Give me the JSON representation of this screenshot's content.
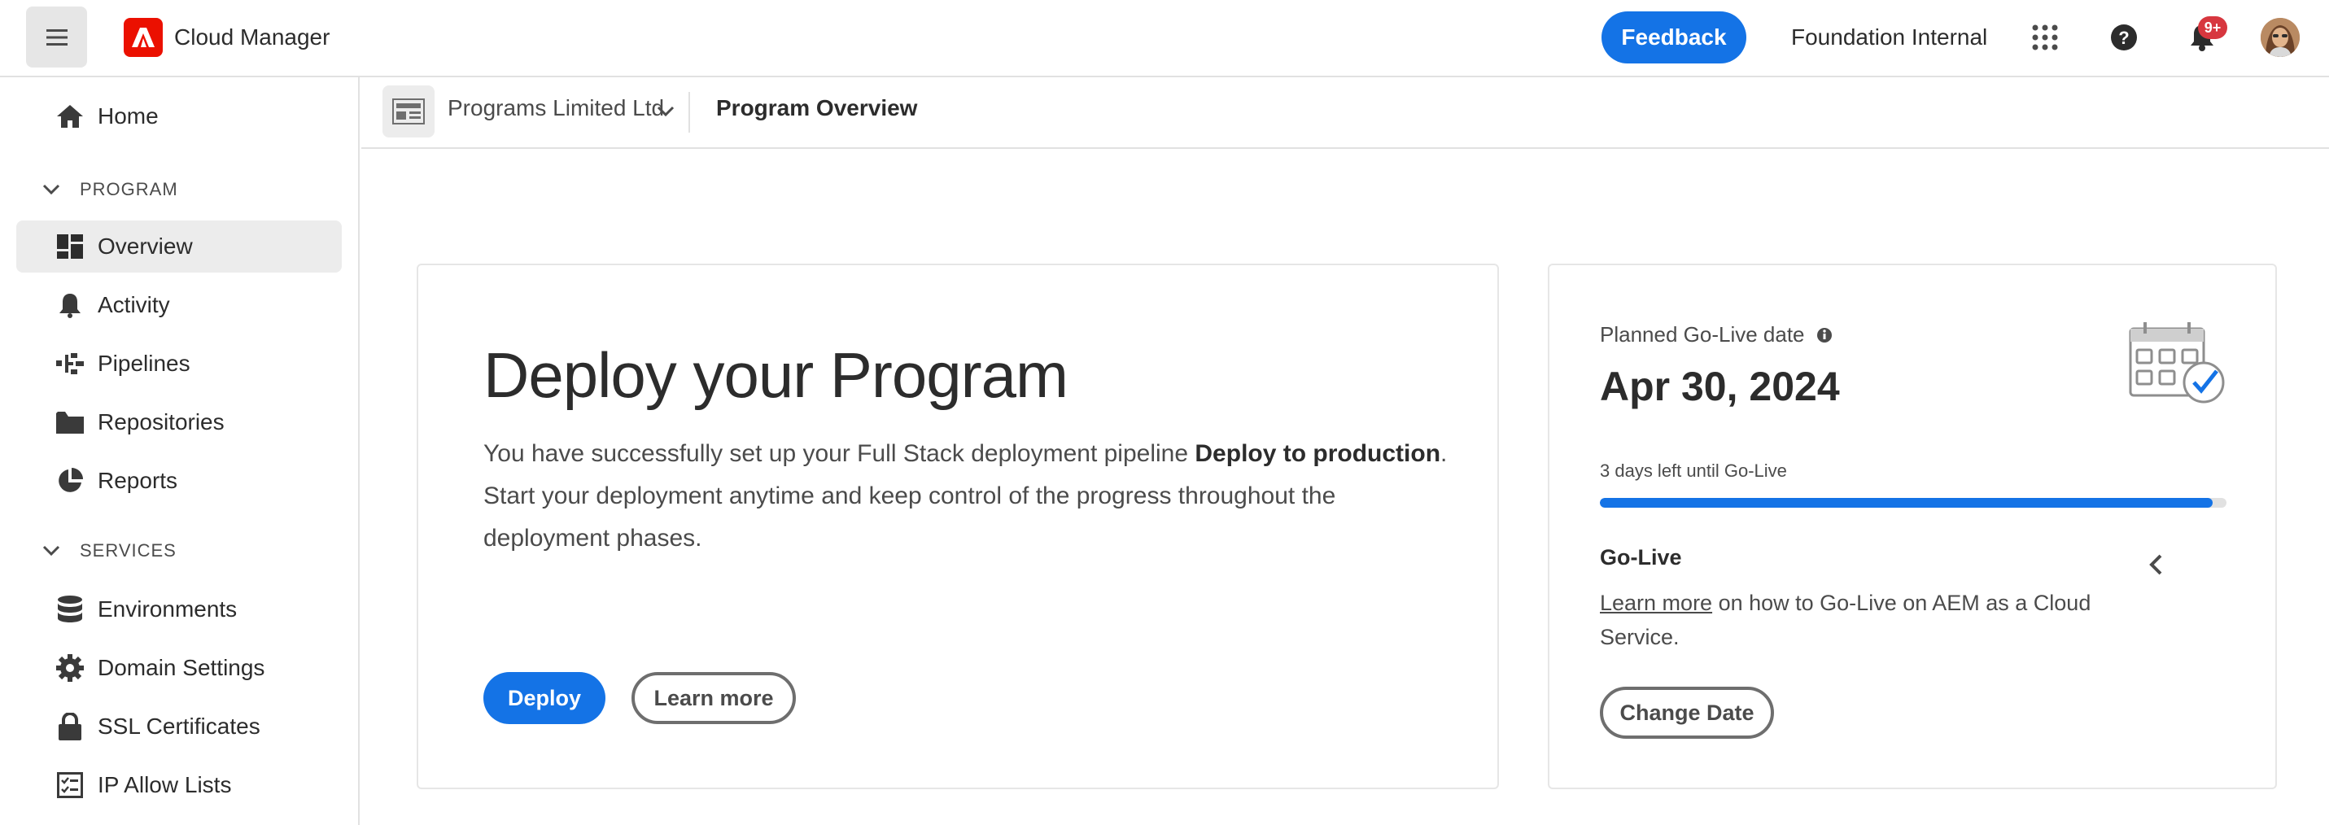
{
  "header": {
    "app_title": "Cloud Manager",
    "feedback_label": "Feedback",
    "org_name": "Foundation Internal",
    "notifications_badge": "9+",
    "icons": [
      "menu-icon",
      "adobe-logo",
      "apps-grid-icon",
      "help-icon",
      "bell-icon",
      "user-avatar"
    ],
    "brand_color": "#eb1000",
    "accent_color": "#1473e6"
  },
  "sidebar": {
    "home_label": "Home",
    "program_section": "PROGRAM",
    "program_items": [
      {
        "label": "Overview",
        "icon": "dashboard-icon",
        "selected": true
      },
      {
        "label": "Activity",
        "icon": "bell-icon"
      },
      {
        "label": "Pipelines",
        "icon": "pipeline-icon"
      },
      {
        "label": "Repositories",
        "icon": "folder-icon"
      },
      {
        "label": "Reports",
        "icon": "pie-chart-icon"
      }
    ],
    "services_section": "SERVICES",
    "services_items": [
      {
        "label": "Environments",
        "icon": "database-icon"
      },
      {
        "label": "Domain Settings",
        "icon": "gear-icon"
      },
      {
        "label": "SSL Certificates",
        "icon": "lock-icon"
      },
      {
        "label": "IP Allow Lists",
        "icon": "checklist-icon"
      }
    ]
  },
  "breadcrumb": {
    "program_name": "Programs Limited Ltd",
    "page_title": "Program Overview"
  },
  "deploy_card": {
    "title": "Deploy your Program",
    "desc_part1": "You have successfully set up your Full Stack deployment pipeline ",
    "desc_bold": "Deploy to production",
    "desc_part2": ". Start your deployment anytime and keep control of the progress throughout the deployment phases.",
    "deploy_label": "Deploy",
    "learn_more_label": "Learn more"
  },
  "golive_card": {
    "label": "Planned Go-Live date",
    "date": "Apr 30, 2024",
    "days_left": "3 days left until Go-Live",
    "progress_percent": 97.8,
    "heading": "Go-Live",
    "link_text": "Learn more",
    "text_rest": " on how to Go-Live on AEM as a Cloud Service.",
    "change_date_label": "Change Date"
  }
}
